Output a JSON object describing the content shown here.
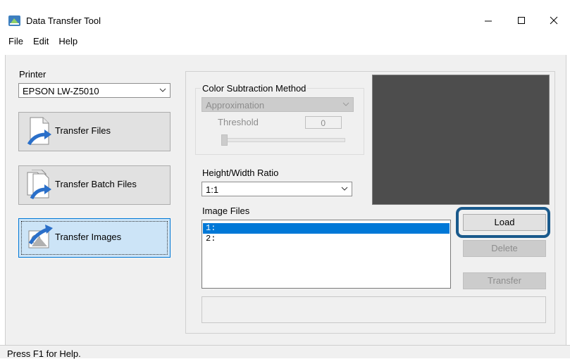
{
  "window": {
    "title": "Data Transfer Tool"
  },
  "menu": [
    "File",
    "Edit",
    "Help"
  ],
  "printer": {
    "label": "Printer",
    "selected": "EPSON LW-Z5010"
  },
  "actions": [
    {
      "label": "Transfer Files",
      "selected": false
    },
    {
      "label": "Transfer Batch Files",
      "selected": false
    },
    {
      "label": "Transfer Images",
      "selected": true
    }
  ],
  "color_subtraction": {
    "label": "Color Subtraction Method",
    "selected": "Approximation",
    "threshold_label": "Threshold",
    "threshold_value": "0"
  },
  "ratio": {
    "label": "Height/Width Ratio",
    "selected": "1:1"
  },
  "image_files": {
    "label": "Image Files",
    "items": [
      "1:",
      "2:"
    ],
    "selected_index": 0
  },
  "buttons": {
    "load": "Load",
    "delete": "Delete",
    "transfer": "Transfer"
  },
  "status": {
    "text": "Press F1 for Help."
  },
  "colors": {
    "highlight": "#0078d7",
    "load_outline": "#1a5a8c",
    "preview_bg": "#4d4d4d"
  }
}
